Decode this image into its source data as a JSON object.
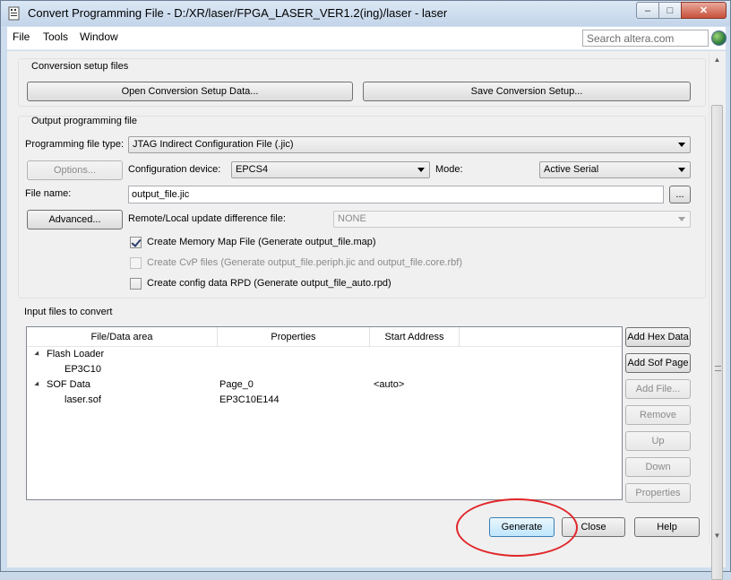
{
  "window": {
    "title": "Convert Programming File - D:/XR/laser/FPGA_LASER_VER1.2(ing)/laser - laser",
    "caption": {
      "minimize": "–",
      "maximize": "□",
      "close": "✕"
    }
  },
  "menubar": {
    "items": [
      "File",
      "Tools",
      "Window"
    ],
    "search_placeholder": "Search altera.com"
  },
  "conversion_setup": {
    "title": "Conversion setup files",
    "open_label": "Open Conversion Setup Data...",
    "save_label": "Save Conversion Setup..."
  },
  "output": {
    "title": "Output programming file",
    "programming_file_type_label": "Programming file type:",
    "programming_file_type_value": "JTAG Indirect Configuration File (.jic)",
    "options_label": "Options...",
    "config_device_label": "Configuration device:",
    "config_device_value": "EPCS4",
    "mode_label": "Mode:",
    "mode_value": "Active Serial",
    "file_name_label": "File name:",
    "file_name_value": "output_file.jic",
    "browse_label": "...",
    "advanced_label": "Advanced...",
    "remote_label": "Remote/Local update difference file:",
    "remote_value": "NONE",
    "checkboxes": [
      {
        "label": "Create Memory Map File (Generate output_file.map)",
        "checked": true,
        "enabled": true
      },
      {
        "label": "Create CvP files (Generate output_file.periph.jic and output_file.core.rbf)",
        "checked": false,
        "enabled": false
      },
      {
        "label": "Create config data RPD (Generate output_file_auto.rpd)",
        "checked": false,
        "enabled": true
      }
    ]
  },
  "input": {
    "title": "Input files to convert",
    "columns": [
      "File/Data area",
      "Properties",
      "Start Address"
    ],
    "rows": [
      {
        "name": "Flash Loader",
        "properties": "",
        "start": ""
      },
      {
        "name": "EP3C10",
        "properties": "",
        "start": ""
      },
      {
        "name": "SOF Data",
        "properties": "Page_0",
        "start": "<auto>"
      },
      {
        "name": "laser.sof",
        "properties": "EP3C10E144",
        "start": ""
      }
    ],
    "buttons": {
      "add_hex": "Add Hex Data",
      "add_sof": "Add Sof Page",
      "add_file": "Add File...",
      "remove": "Remove",
      "up": "Up",
      "down": "Down",
      "properties": "Properties"
    }
  },
  "footer": {
    "generate": "Generate",
    "close": "Close",
    "help": "Help"
  }
}
